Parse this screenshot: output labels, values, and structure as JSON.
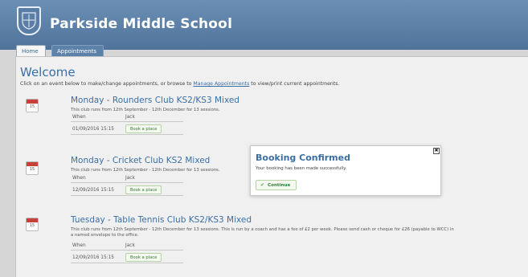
{
  "header": {
    "school_name": "Parkside Middle School"
  },
  "tabs": [
    {
      "label": "Home"
    },
    {
      "label": "Appointments"
    }
  ],
  "main": {
    "welcome": "Welcome",
    "intro_before": "Click on an event below to make/change appointments, or browse to ",
    "intro_link": "Manage Appointments",
    "intro_after": " to view/print current appointments."
  },
  "events": [
    {
      "title": "Monday - Rounders Club KS2/KS3 Mixed",
      "description": "This club runs from 12th September - 12th December for 13 sessions.",
      "col_when": "When",
      "col_person": "Jack",
      "date": "01/09/2016  15:15",
      "button": "Book a place",
      "icon_day": "15"
    },
    {
      "title": "Monday - Cricket Club KS2 Mixed",
      "description": "This club runs from 12th September - 12th December for 13 sessions.",
      "col_when": "When",
      "col_person": "Jack",
      "date": "12/09/2016  15:15",
      "button": "Book a place",
      "icon_day": "15"
    },
    {
      "title": "Tuesday - Table Tennis Club KS2/KS3 Mixed",
      "description": "This club runs from 12th September - 12th December for 13 sessions. This is run by a coach and has a fee of £2 per week. Please send cash or cheque for £26 (payable to WCC) in a named envelope to the office.",
      "col_when": "When",
      "col_person": "Jack",
      "date": "12/09/2016  15:15",
      "button": "Book a place",
      "icon_day": "15"
    }
  ],
  "modal": {
    "title": "Booking Confirmed",
    "message": "Your booking has been made successfully.",
    "continue_label": "Continue",
    "close_glyph": "✖"
  },
  "colors": {
    "accent": "#3b6fa3",
    "header": "#5a7ea6",
    "success": "#5aa54a"
  }
}
